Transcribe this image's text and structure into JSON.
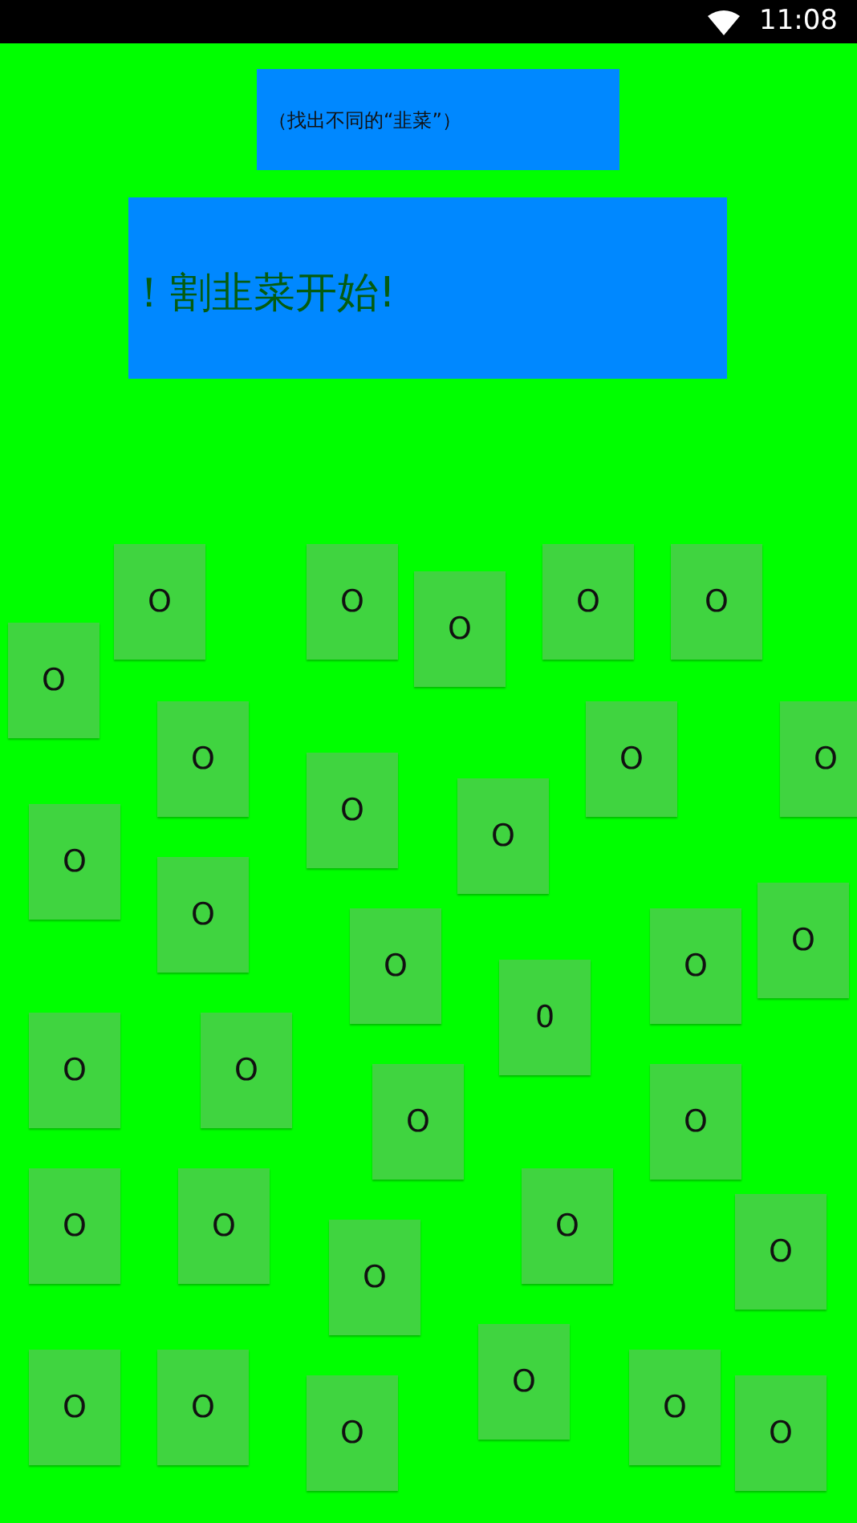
{
  "status_bar": {
    "time": "11:08"
  },
  "hint_card": {
    "text": "（找出不同的“韭菜”）"
  },
  "headline_card": {
    "text": "！割韭菜开始!"
  },
  "tiles": [
    {
      "label": "O"
    },
    {
      "label": "O"
    },
    {
      "label": "O"
    },
    {
      "label": "O"
    },
    {
      "label": "O"
    },
    {
      "label": "O"
    },
    {
      "label": "O"
    },
    {
      "label": "O"
    },
    {
      "label": "O"
    },
    {
      "label": "O"
    },
    {
      "label": "O"
    },
    {
      "label": "O"
    },
    {
      "label": "O"
    },
    {
      "label": "O"
    },
    {
      "label": "O"
    },
    {
      "label": "O"
    },
    {
      "label": "0"
    },
    {
      "label": "O"
    },
    {
      "label": "O"
    },
    {
      "label": "O"
    },
    {
      "label": "O"
    },
    {
      "label": "O"
    },
    {
      "label": "O"
    },
    {
      "label": "O"
    },
    {
      "label": "O"
    },
    {
      "label": "O"
    },
    {
      "label": "O"
    },
    {
      "label": "O"
    },
    {
      "label": "O"
    },
    {
      "label": "O"
    },
    {
      "label": "O"
    },
    {
      "label": "O"
    }
  ]
}
